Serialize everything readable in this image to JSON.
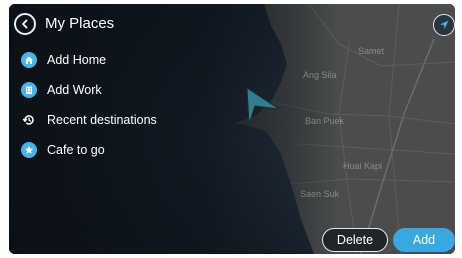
{
  "header": {
    "title": "My Places"
  },
  "menu": {
    "items": [
      {
        "label": "Add Home",
        "icon": "home-icon"
      },
      {
        "label": "Add Work",
        "icon": "work-icon"
      },
      {
        "label": "Recent destinations",
        "icon": "history-icon"
      },
      {
        "label": "Cafe to go",
        "icon": "star-icon"
      }
    ]
  },
  "map": {
    "places": [
      "Samet",
      "Ang Sila",
      "Ban Puek",
      "Huai Kapi",
      "Saen Suk"
    ]
  },
  "actions": {
    "delete_label": "Delete",
    "add_label": "Add"
  },
  "colors": {
    "accent": "#3aa8e0",
    "icon_blue": "#45b6e8",
    "map_land": "#4a4d4c",
    "map_sea": "#1e2a36",
    "position_marker": "#2f7f8f"
  }
}
